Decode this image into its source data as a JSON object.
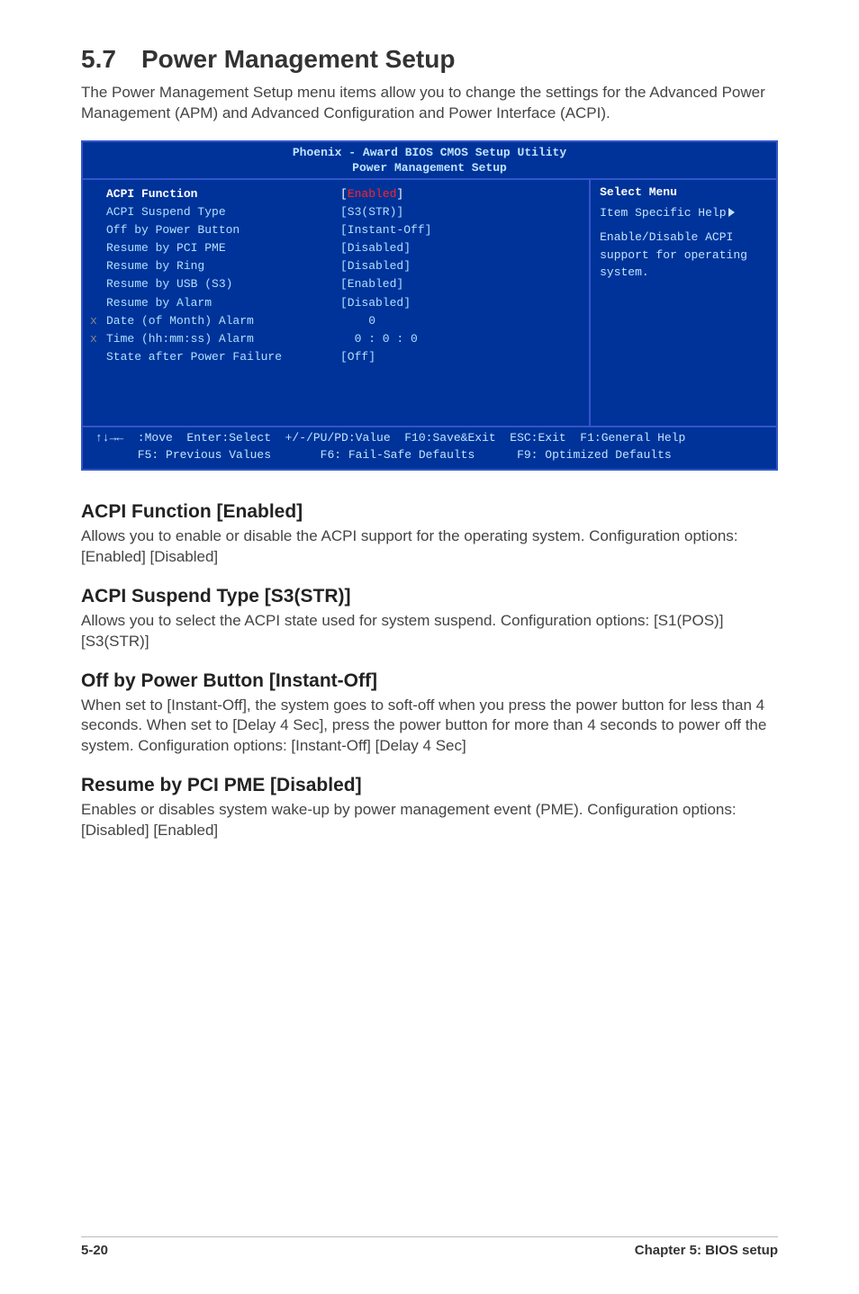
{
  "section": {
    "number": "5.7",
    "title": "Power Management Setup"
  },
  "intro": "The Power Management Setup menu items allow you to change the settings for the Advanced Power Management (APM) and Advanced Configuration and Power Interface (ACPI).",
  "bios": {
    "header1": "Phoenix - Award BIOS CMOS Setup Utility",
    "header2": "Power Management Setup",
    "rows": [
      {
        "x": "",
        "label": "ACPI Function",
        "value": "[Enabled]",
        "first": true,
        "red": true
      },
      {
        "x": "",
        "label": "ACPI Suspend Type",
        "value": "[S3(STR)]"
      },
      {
        "x": "",
        "label": "Off by Power Button",
        "value": "[Instant-Off]"
      },
      {
        "x": "",
        "label": "Resume by PCI PME",
        "value": "[Disabled]"
      },
      {
        "x": "",
        "label": "Resume by Ring",
        "value": "[Disabled]"
      },
      {
        "x": "",
        "label": "Resume by USB (S3)",
        "value": "[Enabled]"
      },
      {
        "x": "",
        "label": "Resume by Alarm",
        "value": "[Disabled]"
      },
      {
        "x": "x",
        "label": "Date (of Month) Alarm",
        "value": "    0"
      },
      {
        "x": "x",
        "label": "Time (hh:mm:ss) Alarm",
        "value": "  0 : 0 : 0"
      },
      {
        "x": "",
        "label": "State after Power Failure",
        "value": "[Off]"
      }
    ],
    "right": {
      "select": "Select Menu",
      "helpLabel": "Item Specific Help",
      "helpText": "Enable/Disable ACPI support for operating system."
    },
    "footer1": "↑↓→←  :Move  Enter:Select  +/-/PU/PD:Value  F10:Save&Exit  ESC:Exit  F1:General Help",
    "footer2": "      F5: Previous Values       F6: Fail-Safe Defaults      F9: Optimized Defaults"
  },
  "subs": [
    {
      "title": "ACPI Function [Enabled]",
      "body": "Allows you to enable or disable the ACPI support for the operating system. Configuration options: [Enabled] [Disabled]"
    },
    {
      "title": "ACPI Suspend Type [S3(STR)]",
      "body": "Allows you to select the ACPI state used for system suspend. Configuration options: [S1(POS)] [S3(STR)]"
    },
    {
      "title": "Off by Power Button [Instant-Off]",
      "body": "When set to [Instant-Off], the system goes to soft-off when you press the power button for less than 4 seconds. When set to [Delay 4 Sec], press the power button for more than 4 seconds to power off the system. Configuration options: [Instant-Off] [Delay 4 Sec]"
    },
    {
      "title": "Resume by PCI PME [Disabled]",
      "body": "Enables or disables system wake-up by power management event (PME). Configuration options: [Disabled] [Enabled]"
    }
  ],
  "footer": {
    "page": "5-20",
    "chapter": "Chapter 5: BIOS setup"
  }
}
